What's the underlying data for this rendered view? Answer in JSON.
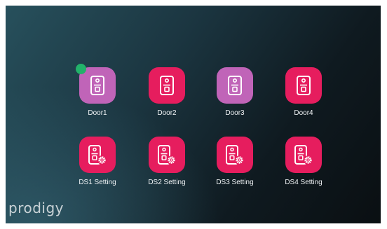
{
  "brand": {
    "name": "prodigy"
  },
  "colors": {
    "active": "#e61d5e",
    "dimmed": "#c064b8",
    "status_online": "#22b26a",
    "icon_stroke": "#ffffff"
  },
  "doors": [
    {
      "label": "Door1",
      "state": "dimmed",
      "icon": "doorbell-icon",
      "status": "online"
    },
    {
      "label": "Door2",
      "state": "active",
      "icon": "doorbell-icon"
    },
    {
      "label": "Door3",
      "state": "dimmed",
      "icon": "doorbell-icon"
    },
    {
      "label": "Door4",
      "state": "active",
      "icon": "doorbell-icon"
    }
  ],
  "settings": [
    {
      "label": "DS1 Setting",
      "state": "active",
      "icon": "doorbell-settings-icon"
    },
    {
      "label": "DS2 Setting",
      "state": "active",
      "icon": "doorbell-settings-icon"
    },
    {
      "label": "DS3 Setting",
      "state": "active",
      "icon": "doorbell-settings-icon"
    },
    {
      "label": "DS4 Setting",
      "state": "active",
      "icon": "doorbell-settings-icon"
    }
  ]
}
